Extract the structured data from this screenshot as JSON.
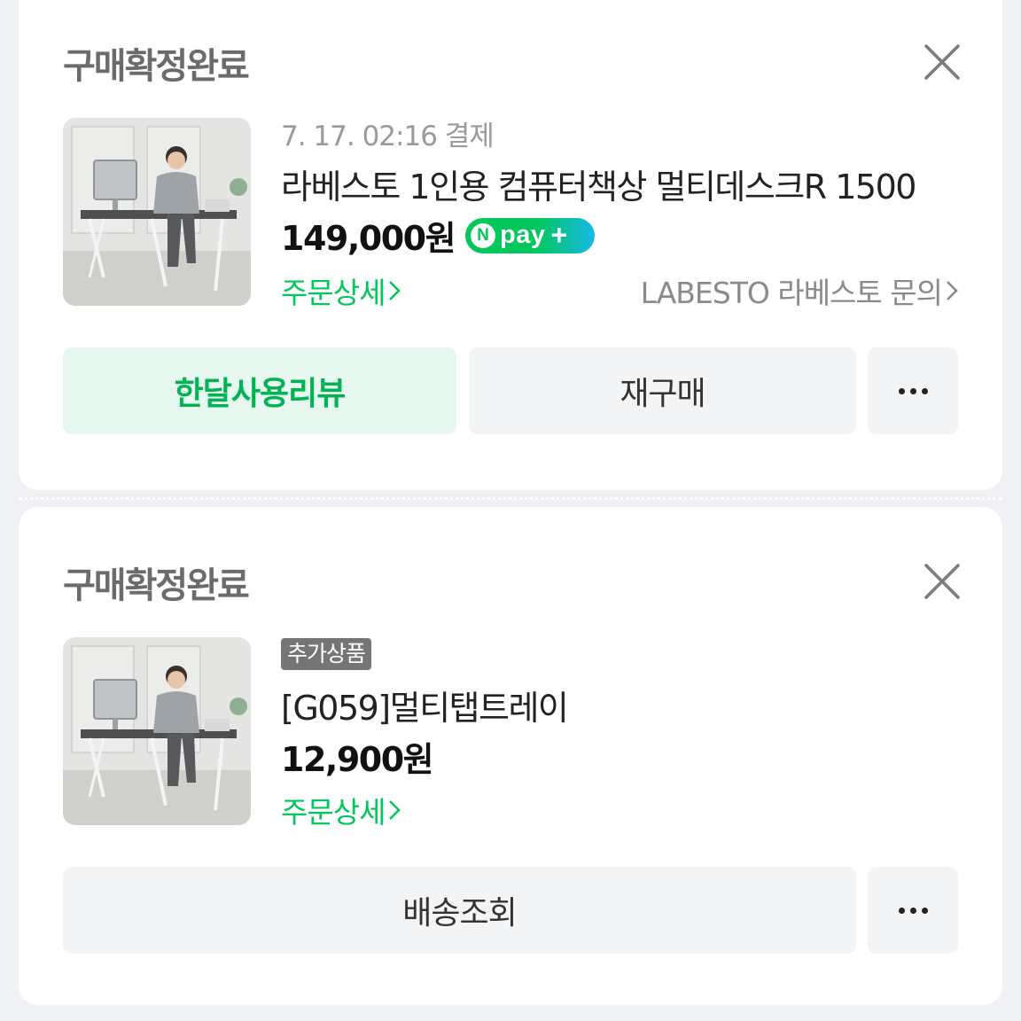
{
  "orders": [
    {
      "status": "구매확정완료",
      "date": "7. 17. 02:16 결제",
      "product_title": "라베스토 1인용 컴퓨터책상 멀티데스크R 1500",
      "price": "149,000원",
      "npay": {
        "n": "N",
        "label": "pay",
        "plus": "+"
      },
      "order_detail_label": "주문상세",
      "seller_inquiry_label": "LABESTO 라베스토 문의",
      "buttons": {
        "primary": "한달사용리뷰",
        "secondary": "재구매"
      },
      "icons": {
        "close": "close-icon",
        "more": "more-dots-icon",
        "chevron": "chevron-right-icon"
      }
    },
    {
      "status": "구매확정완료",
      "badge": "추가상품",
      "product_title": "[G059]멀티탭트레이",
      "price": "12,900원",
      "order_detail_label": "주문상세",
      "buttons": {
        "primary": "배송조회"
      },
      "icons": {
        "close": "close-icon",
        "more": "more-dots-icon",
        "chevron": "chevron-right-icon"
      }
    }
  ],
  "colors": {
    "background": "#eff1f4",
    "card": "#ffffff",
    "accent_green": "#03c75a",
    "review_button_bg": "#e6f8ef",
    "button_bg": "#f3f4f6",
    "badge_bg": "#757575"
  }
}
